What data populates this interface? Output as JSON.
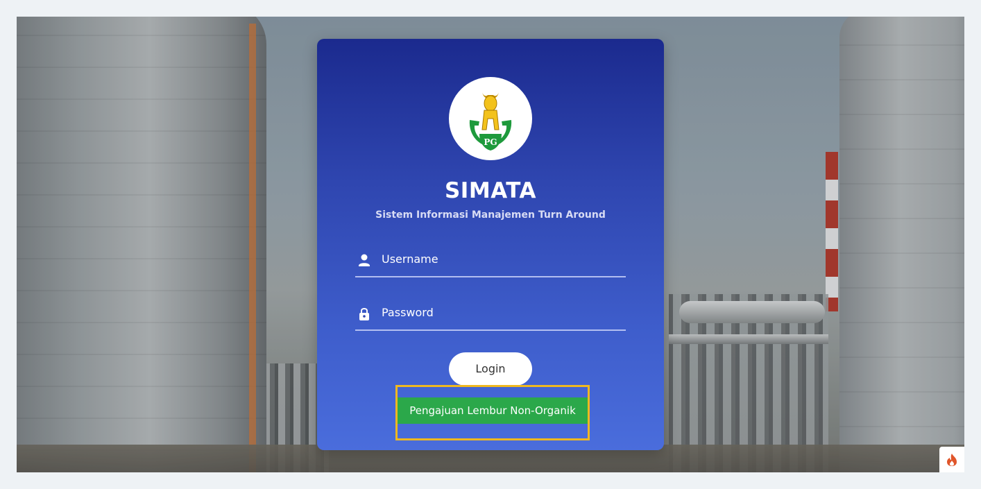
{
  "app": {
    "title": "SIMATA",
    "subtitle": "Sistem Informasi Manajemen Turn Around",
    "logo_text": "PG",
    "logo_icon": "petrokimia-gresik-bull-logo"
  },
  "form": {
    "username_placeholder": "Username",
    "username_icon": "user-icon",
    "password_placeholder": "Password",
    "password_icon": "lock-icon",
    "login_label": "Login"
  },
  "actions": {
    "lembur_label": "Pengajuan Lembur Non-Organik"
  },
  "colors": {
    "card_top": "#1b2a8e",
    "card_bottom": "#4a6ddc",
    "lembur_bg": "#2ba84a",
    "highlight": "#f0b820"
  },
  "badge": {
    "icon": "fire-icon"
  }
}
